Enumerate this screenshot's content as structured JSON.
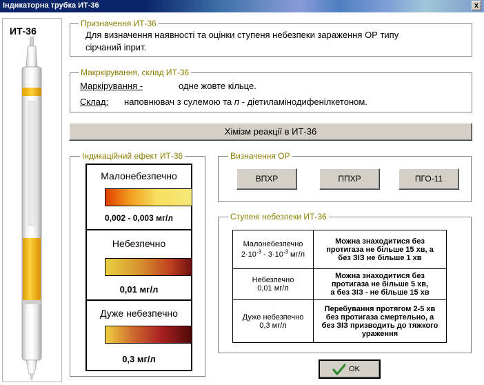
{
  "window": {
    "title": "Індикаторна трубка ИТ-36",
    "close_label": "x"
  },
  "tube": {
    "label": "ИТ-36"
  },
  "purpose": {
    "title": "Призначення ИТ-36",
    "line1": "Для визначення наявності та оцінки ступеня небезпеки зараження ОР типу",
    "line2": "сірчаний іприт."
  },
  "marking": {
    "title": "Макркірування, склад ИТ-36",
    "marking_label": "Маркірування -",
    "marking_value": "одне жовте кільце.",
    "composition_label": "Склад:",
    "composition_value_a": "наповнювач з сулемою  та ",
    "composition_n": "п",
    "composition_value_b": " - діетиламінодифенілкетоном."
  },
  "chem_button": "Хімізм реакції в ИТ-36",
  "indication": {
    "title": "Індикаційний ефект ИТ-36",
    "levels": [
      {
        "name": "Малонебезпечно",
        "value": "0,002 - 0,003 мг/л"
      },
      {
        "name": "Небезпечно",
        "value": "0,01 мг/л"
      },
      {
        "name": "Дуже небезпечно",
        "value": "0,3 мг/л"
      }
    ]
  },
  "detection": {
    "title": "Визначення ОР",
    "buttons": [
      "ВПХР",
      "ППХР",
      "ПГО-11"
    ]
  },
  "degrees": {
    "title": "Ступені небезпеки ИТ-36",
    "rows": [
      {
        "level_name": "Малонебезпечно",
        "level_value_a": "2·10",
        "level_exp_a": "-3",
        "level_mid": " - 3·10",
        "level_exp_b": "-3",
        "level_unit": " мг/л",
        "desc": [
          "Можна знаходитися без",
          "протигаза не більше 15 хв, а",
          "без ЗІЗ не більше 1 хв"
        ]
      },
      {
        "level_name": "Небезпечно",
        "level_value": "0,01 мг/л",
        "desc": [
          "Можна знаходитися без",
          "протигаза не більше 5 хв,",
          "а без ЗІЗ - не більше 15 хв"
        ]
      },
      {
        "level_name": "Дуже небезпечно",
        "level_value": "0,3 мг/л",
        "desc": [
          "Перебування  протягом 2-5 хв",
          "без протигаза смертельно, а",
          "без ЗІЗ призводить до тяжкого",
          "ураження"
        ]
      }
    ]
  },
  "ok_button": "OK",
  "colors": {
    "group_title": "#8b7d00",
    "ok_check": "#2e8b2e",
    "tube_yellow": "#f5b400"
  }
}
